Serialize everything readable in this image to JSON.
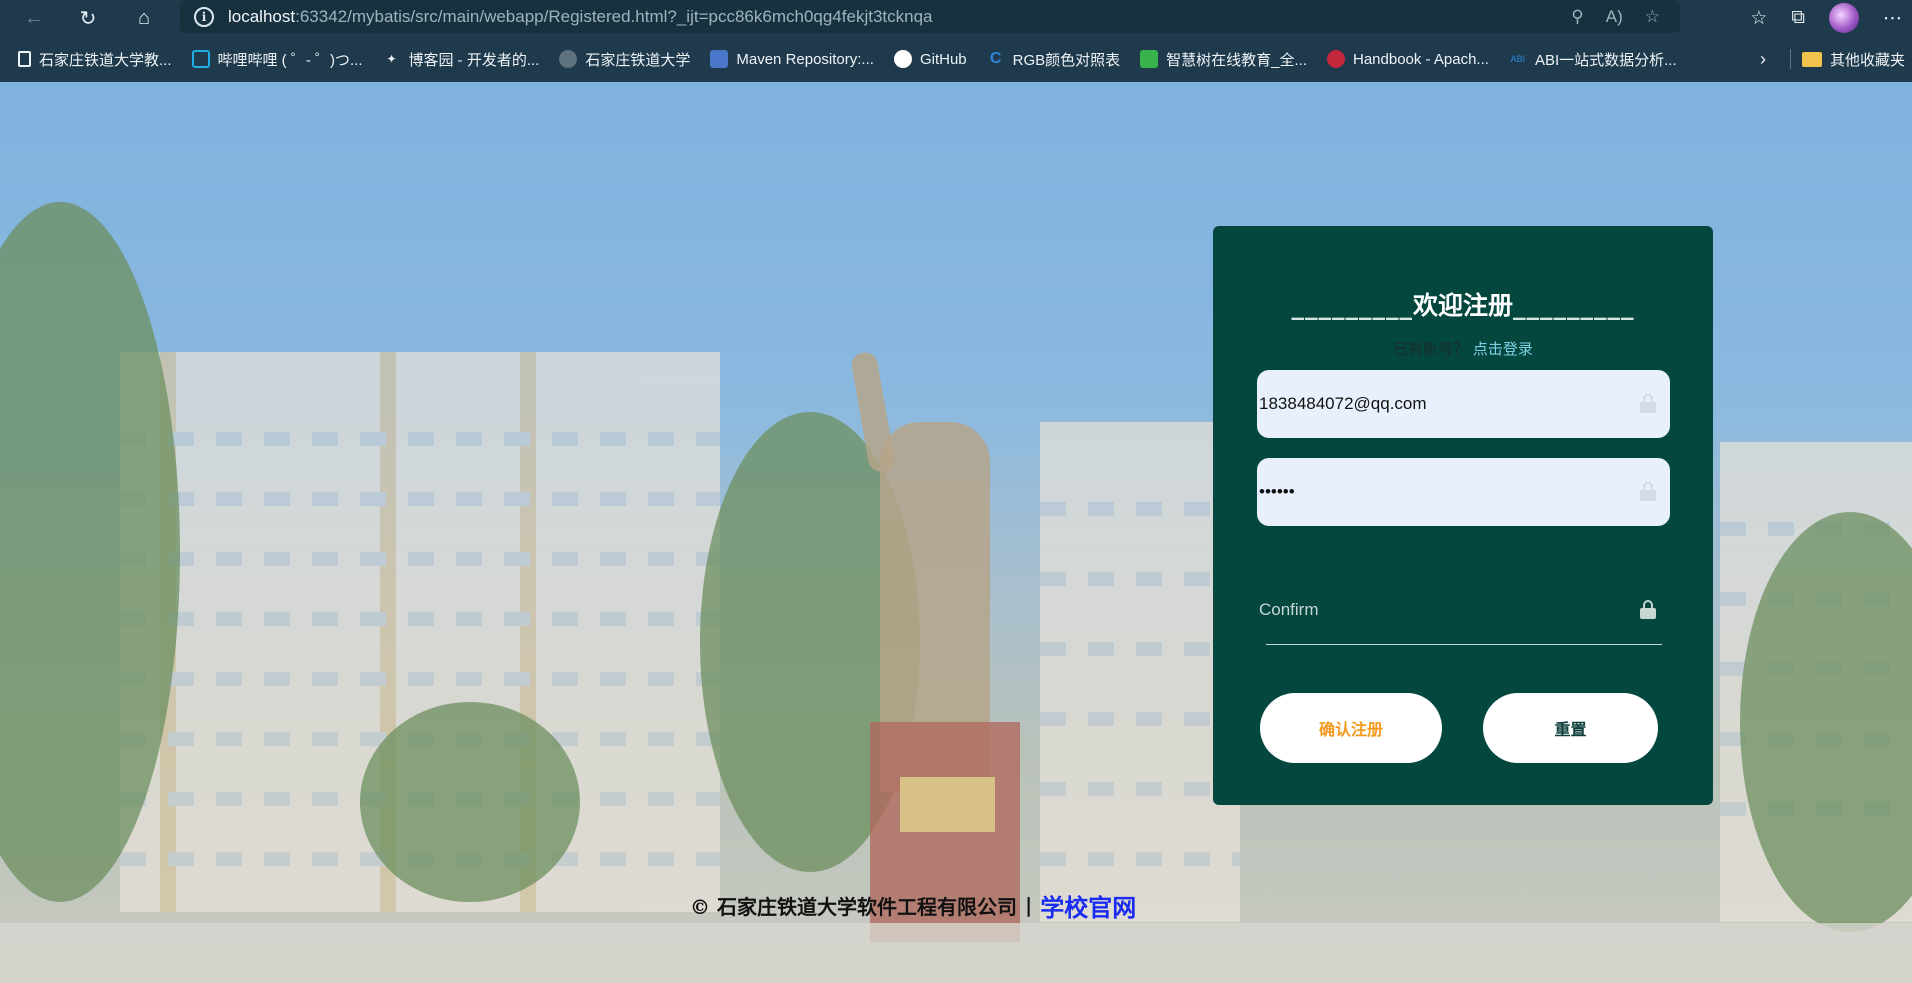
{
  "browser": {
    "url_host": "localhost",
    "url_rest": ":63342/mybatis/src/main/webapp/Registered.html?_ijt=pcc86k6mch0qg4fekjt3tcknqa"
  },
  "bookmarks": [
    {
      "label": "石家庄铁道大学教...",
      "icon": "page-icon",
      "color": "#eef3f6"
    },
    {
      "label": "哔哩哔哩 ( ゜- ゜)つ...",
      "icon": "bilibili-icon",
      "color": "#23ade5"
    },
    {
      "label": "博客园 - 开发者的...",
      "icon": "cnblogs-icon",
      "color": "#eef3f6"
    },
    {
      "label": "石家庄铁道大学",
      "icon": "globe-icon",
      "color": "#5e7280"
    },
    {
      "label": "Maven Repository:...",
      "icon": "maven-icon",
      "color": "#4a77c9"
    },
    {
      "label": "GitHub",
      "icon": "github-icon",
      "color": "#ffffff"
    },
    {
      "label": "RGB颜色对照表",
      "icon": "rgb-icon",
      "color": "#2f86e0"
    },
    {
      "label": "智慧树在线教育_全...",
      "icon": "zhihuishu-icon",
      "color": "#38b24a"
    },
    {
      "label": "Handbook - Apach...",
      "icon": "handbook-icon",
      "color": "#c2283b"
    },
    {
      "label": "ABI一站式数据分析...",
      "icon": "abi-icon",
      "color": "#2f86e0"
    }
  ],
  "bookmarks_other": "其他收藏夹",
  "card": {
    "title_left": "_________",
    "title": "欢迎注册",
    "title_right": "_________",
    "have_account": "已有账号？",
    "login_link": "点击登录",
    "email_value": "1838484072@qq.com",
    "password_value": "••••••",
    "confirm_placeholder": "Confirm",
    "confirm_button": "确认注册",
    "reset_button": "重置"
  },
  "footer": {
    "copyright": "© 石家庄铁道大学软件工程有限公司",
    "separator": "|",
    "site_link": "学校官网"
  }
}
